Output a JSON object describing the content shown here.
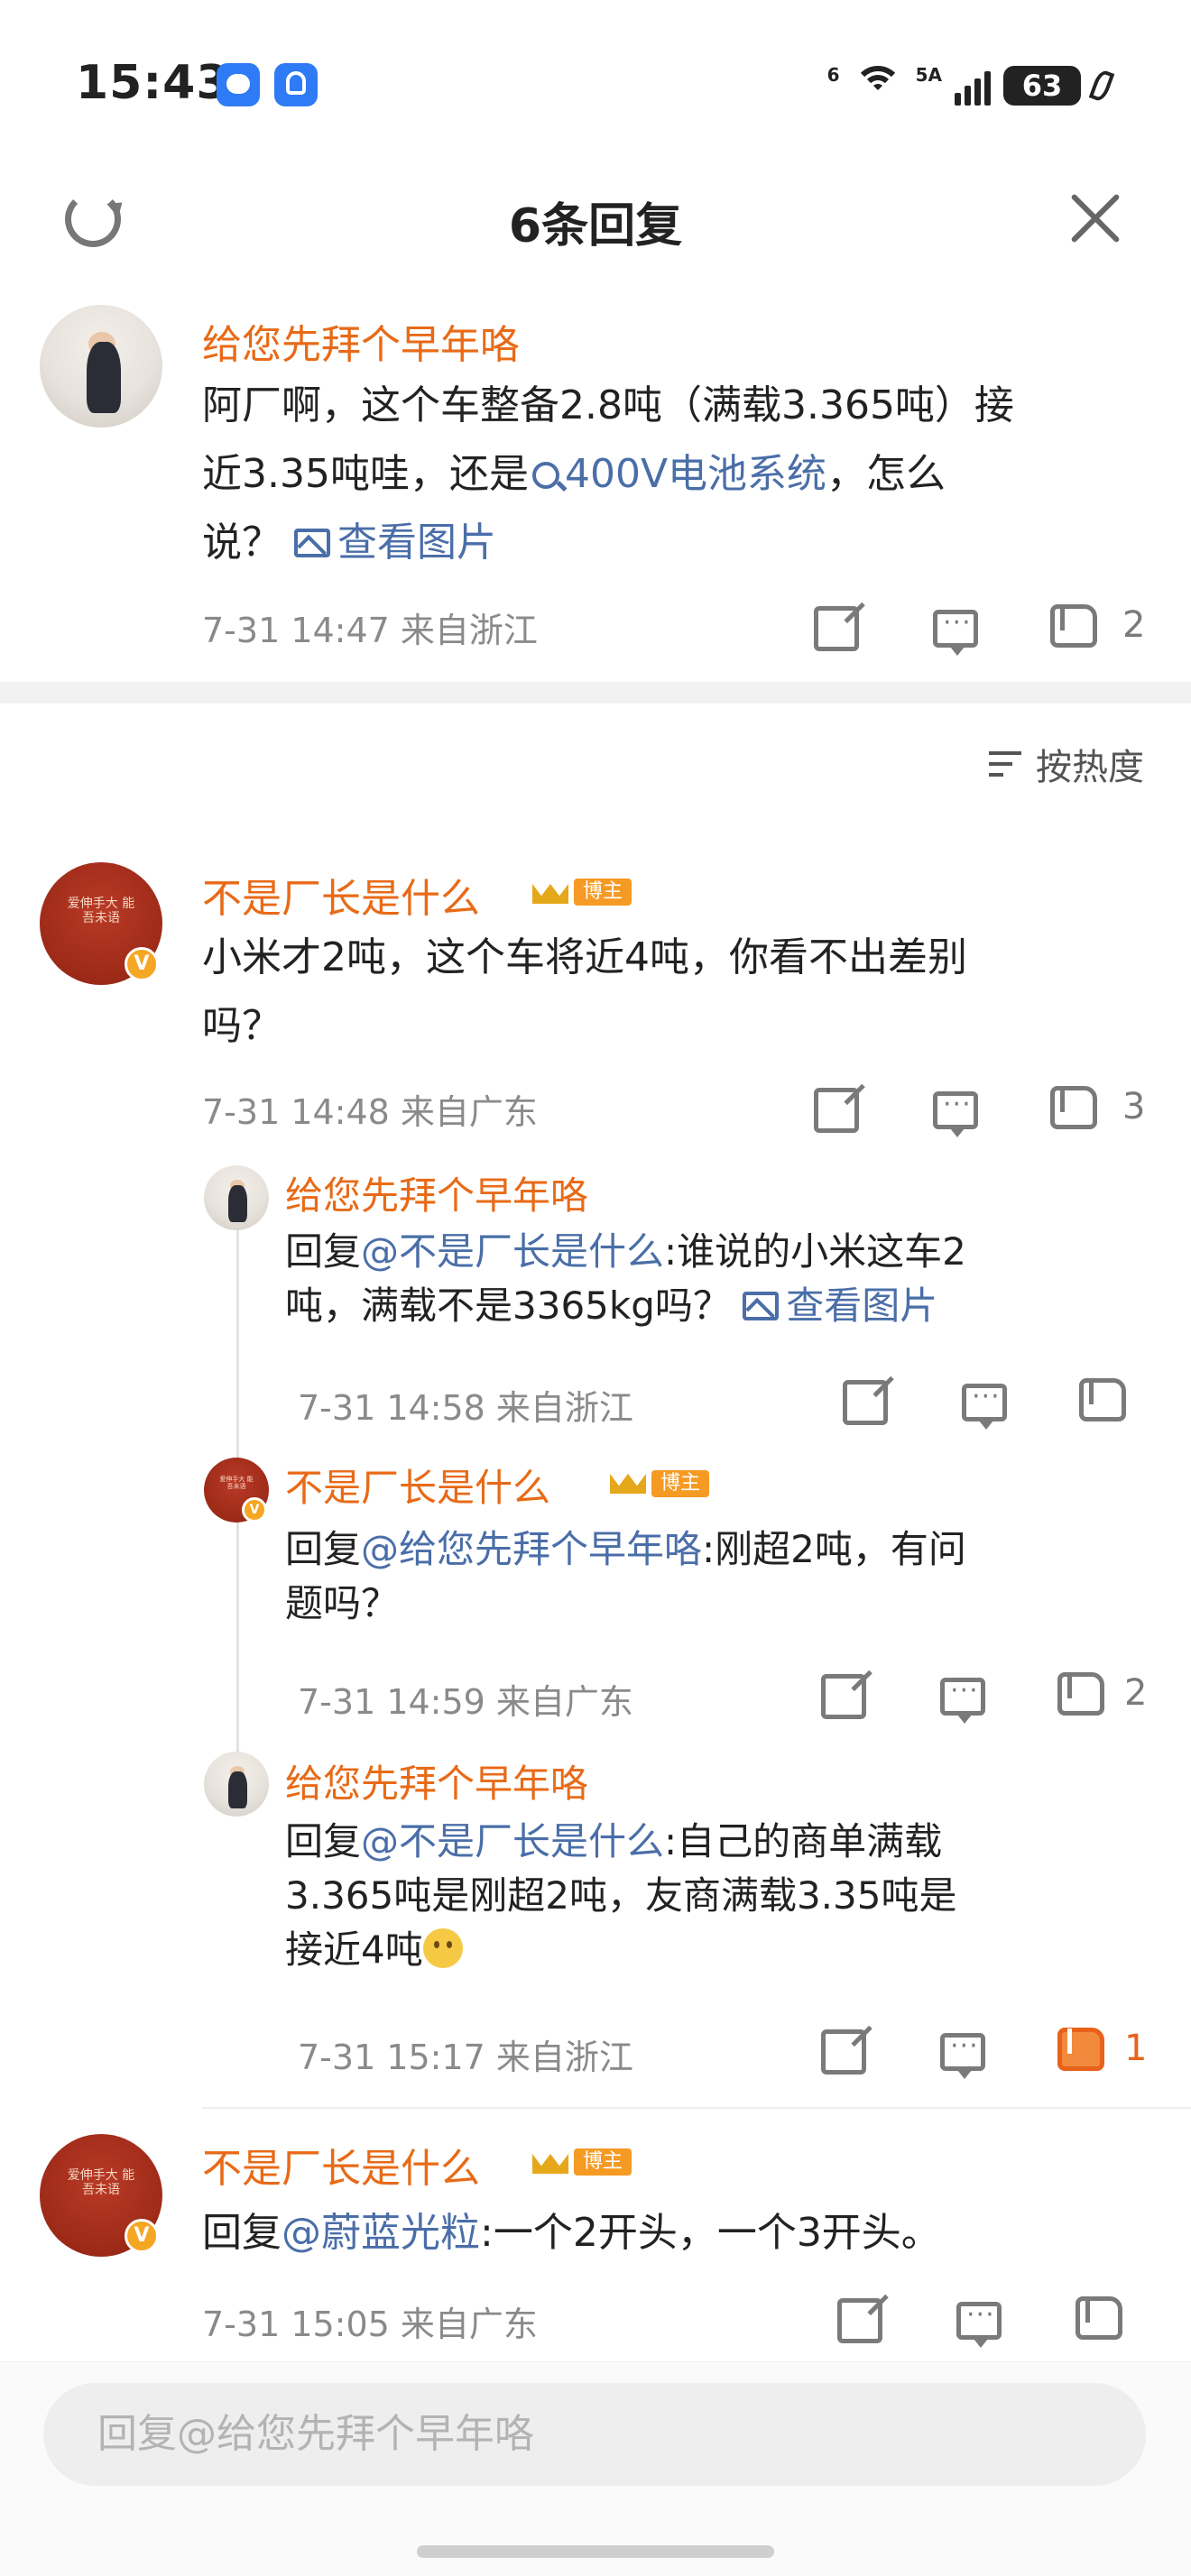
{
  "status": {
    "time": "15:43",
    "battery": "63",
    "network": "5A",
    "wifi_label": "6"
  },
  "header": {
    "title": "6条回复"
  },
  "main": {
    "user": "给您先拜个早年咯",
    "text_a": "阿厂啊，这个车整备2.8吨（满载3.365吨）接",
    "text_b": "近3.35吨哇，还是",
    "topic": "400V电池系统",
    "text_c": "，怎么",
    "text_d": "说？",
    "view_image": "查看图片",
    "meta": "7-31 14:47 来自浙江",
    "likes": "2"
  },
  "sort_label": "按热度",
  "badge_label": "博主",
  "verified_mark": "V",
  "comments": [
    {
      "user": "不是厂长是什么",
      "text_line1": "小米才2吨，这个车将近4吨，你看不出差别",
      "text_line2": "吗？",
      "meta": "7-31 14:48 来自广东",
      "likes": "3"
    },
    {
      "user": "给您先拜个早年咯",
      "reply_prefix": "回复",
      "mention": "@不是厂长是什么",
      "text_line1": ":谁说的小米这车2",
      "text_line2": "吨，满载不是3365kg吗？",
      "view_image": "查看图片",
      "meta": "7-31 14:58 来自浙江"
    },
    {
      "user": "不是厂长是什么",
      "reply_prefix": "回复",
      "mention": "@给您先拜个早年咯",
      "text_line1": ":刚超2吨，有问",
      "text_line2": "题吗？",
      "meta": "7-31 14:59 来自广东",
      "likes": "2"
    },
    {
      "user": "给您先拜个早年咯",
      "reply_prefix": "回复",
      "mention": "@不是厂长是什么",
      "text_line1": ":自己的商单满载",
      "text_line2": "3.365吨是刚超2吨，友商满载3.35吨是",
      "text_line3": "接近4吨",
      "meta": "7-31 15:17 来自浙江",
      "likes": "1"
    },
    {
      "user": "不是厂长是什么",
      "reply_prefix": "回复",
      "mention": "@蔚蓝光粒",
      "text_line1": ":一个2开头，一个3开头。",
      "meta": "7-31 15:05 来自广东"
    }
  ],
  "avatar_text": "爱伸手大 能吾未语",
  "reply_box": {
    "placeholder": "回复@给您先拜个早年咯"
  },
  "colors": {
    "accent": "#e86a17",
    "link": "#4a6ea8",
    "badge": "#f59a23"
  }
}
